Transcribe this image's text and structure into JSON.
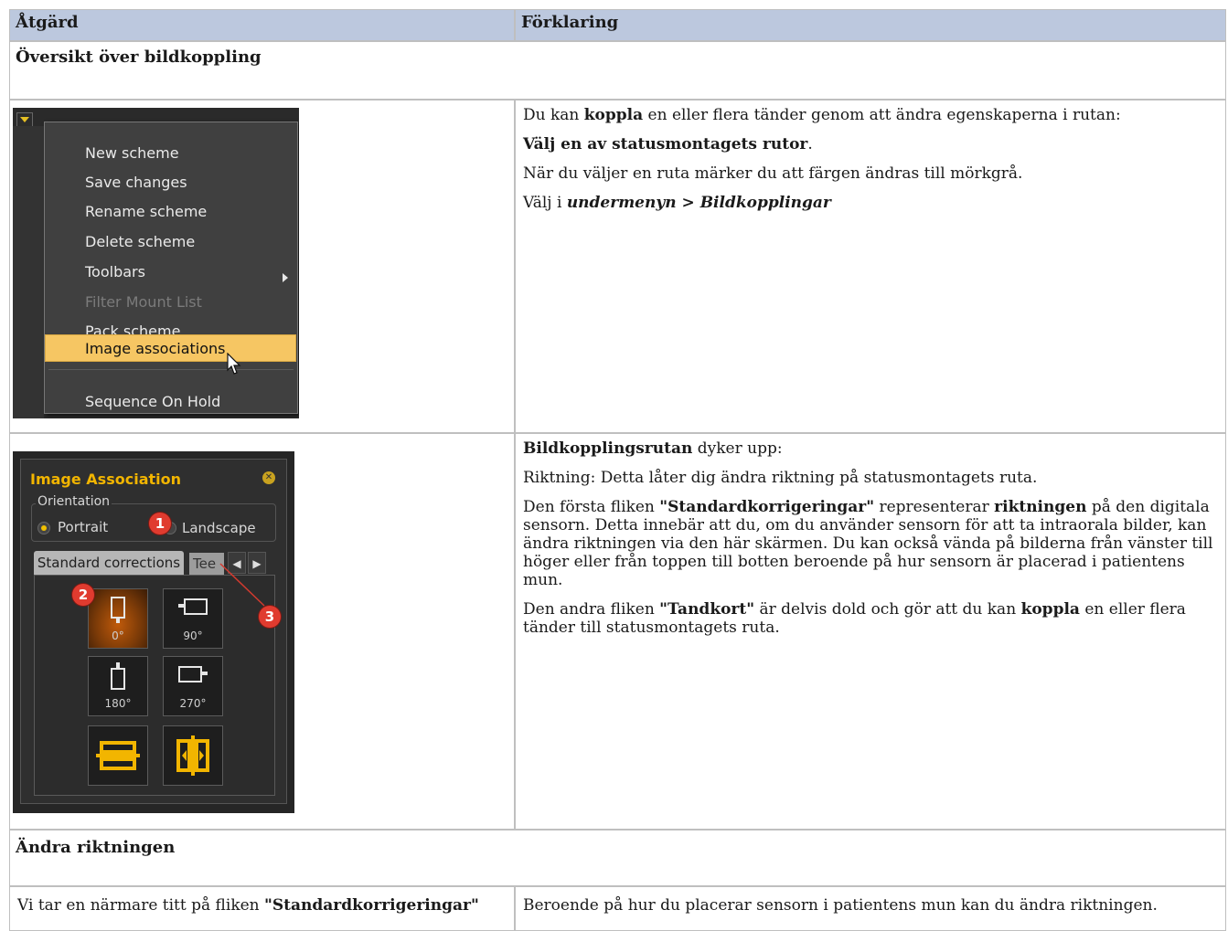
{
  "table": {
    "col_action": "Åtgärd",
    "col_explanation": "Förklaring"
  },
  "sections": {
    "overview": "Översikt över bildkoppling",
    "change_orientation": "Ändra riktningen"
  },
  "row1": {
    "p1_pre": "Du kan ",
    "p1_bold": "koppla",
    "p1_post": " en eller flera tänder genom att ändra egenskaperna i rutan:",
    "p2_bold": "Välj en av statusmontagets rutor",
    "p2_post": ".",
    "p3": "När du väljer en ruta märker du att färgen ändras till mörkgrå.",
    "p4_pre": "Välj i ",
    "p4_em1": "undermenyn",
    "p4_gt": " > ",
    "p4_em2": "Bildkopplingar"
  },
  "menu": {
    "items": [
      "New scheme",
      "Save changes",
      "Rename scheme",
      "Delete scheme",
      "Toolbars",
      "Filter Mount List",
      "Pack scheme",
      "Image associations",
      "Sequence On Hold"
    ],
    "icons": {
      "dropdown": "dropdown-arrow-icon",
      "submenu": "submenu-arrow-icon",
      "cursor": "mouse-pointer-icon"
    },
    "highlight_color": "#f6c663"
  },
  "row2": {
    "p1_bold": "Bildkopplingsrutan",
    "p1_post": " dyker upp:",
    "p2": " Riktning: Detta låter dig ändra riktning på statusmontagets ruta.",
    "p3_pre": " Den första fliken ",
    "p3_bold1": "\"Standardkorrigeringar\"",
    "p3_mid": " representerar ",
    "p3_bold2": "riktningen",
    "p3_post": " på den digitala sensorn.  Detta innebär att du, om du använder sensorn för att ta intraorala bilder, kan ändra riktningen via den här skärmen. Du kan också vända på bilderna från vänster till höger eller från toppen till botten beroende på hur sensorn är placerad i patientens mun.",
    "p4_pre": " Den andra fliken ",
    "p4_bold1": "\"Tandkort\"",
    "p4_mid": " är delvis dold och gör att du kan ",
    "p4_bold2": "koppla",
    "p4_post": " en eller flera tänder till statusmontagets ruta."
  },
  "panel": {
    "title": "Image Association",
    "orientation_legend": "Orientation",
    "portrait": "Portrait",
    "landscape": "Landscape",
    "tab_standard": "Standard corrections",
    "tab_teeth": "Tee",
    "degrees": [
      "0°",
      "90°",
      "180°",
      "270°"
    ],
    "badges": [
      "1",
      "2",
      "3"
    ],
    "icons": {
      "close": "close-icon",
      "tab_prev": "chevron-left-icon",
      "tab_next": "chevron-right-icon",
      "flip_vertical": "flip-vertical-icon",
      "flip_horizontal": "flip-horizontal-icon"
    },
    "accent_color": "#f2b500",
    "badge_color": "#e03b2f"
  },
  "row3": {
    "action_pre": "Vi tar en närmare titt på fliken ",
    "action_bold": "\"Standardkorrigeringar\"",
    "explanation": "Beroende på hur du placerar sensorn i patientens mun kan du ändra riktningen."
  }
}
